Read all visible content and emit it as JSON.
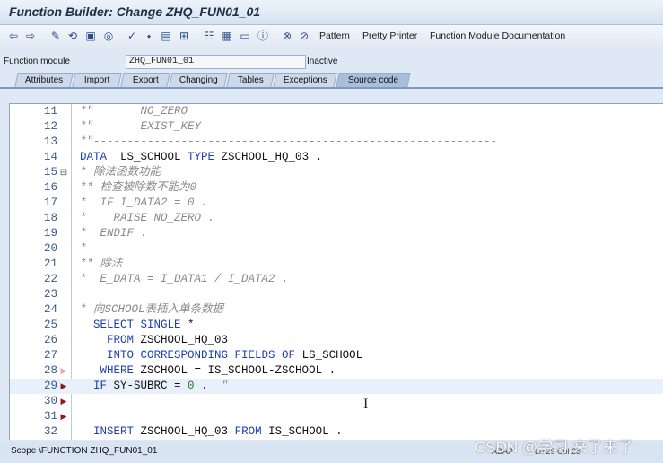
{
  "window": {
    "title": "Function Builder: Change ZHQ_FUN01_01"
  },
  "toolbar": {
    "icons": [
      "back-arrow-icon",
      "forward-arrow-icon",
      "edit-pencil-icon",
      "toggle-display-change-icon",
      "other-object-icon",
      "activate-icon",
      "check-icon",
      "where-used-icon",
      "breakpoint-icon",
      "pretty-print-icon",
      "display-object-list-icon",
      "navigate-icon",
      "test-icon",
      "insert-statement-icon",
      "info-icon",
      "stop-icon",
      "stop-all-icon"
    ],
    "pattern_label": "Pattern",
    "pretty_printer_label": "Pretty Printer",
    "doc_label": "Function Module Documentation"
  },
  "header": {
    "field_label": "Function module",
    "field_value": "ZHQ_FUN01_01",
    "status": "Inactive"
  },
  "tabs": [
    {
      "label": "Attributes"
    },
    {
      "label": "Import"
    },
    {
      "label": "Export"
    },
    {
      "label": "Changing"
    },
    {
      "label": "Tables"
    },
    {
      "label": "Exceptions"
    },
    {
      "label": "Source code",
      "active": true
    }
  ],
  "editor": {
    "lines": [
      {
        "n": "11",
        "mark": "",
        "parts": [
          [
            "cm",
            "*\"       NO_ZERO"
          ]
        ]
      },
      {
        "n": "12",
        "mark": "",
        "parts": [
          [
            "cm",
            "*\"       EXIST_KEY"
          ]
        ]
      },
      {
        "n": "13",
        "mark": "",
        "parts": [
          [
            "cm",
            "*\"------------------------------------------------------------"
          ]
        ]
      },
      {
        "n": "14",
        "mark": "",
        "parts": [
          [
            "kw",
            "DATA"
          ],
          [
            "tx",
            "  LS_SCHOOL "
          ],
          [
            "kw",
            "TYPE"
          ],
          [
            "tx",
            " ZSCHOOL_HQ_03 ."
          ]
        ]
      },
      {
        "n": "15",
        "mark": "⊟",
        "parts": [
          [
            "cm",
            "* 除法函数功能"
          ]
        ]
      },
      {
        "n": "16",
        "mark": "",
        "parts": [
          [
            "cm",
            "** 检查被除数不能为0"
          ]
        ]
      },
      {
        "n": "17",
        "mark": "",
        "parts": [
          [
            "cm",
            "*  IF I_DATA2 = 0 ."
          ]
        ]
      },
      {
        "n": "18",
        "mark": "",
        "parts": [
          [
            "cm",
            "*    RAISE NO_ZERO ."
          ]
        ]
      },
      {
        "n": "19",
        "mark": "",
        "parts": [
          [
            "cm",
            "*  ENDIF ."
          ]
        ]
      },
      {
        "n": "20",
        "mark": "",
        "parts": [
          [
            "cm",
            "*"
          ]
        ]
      },
      {
        "n": "21",
        "mark": "",
        "parts": [
          [
            "cm",
            "** 除法"
          ]
        ]
      },
      {
        "n": "22",
        "mark": "",
        "parts": [
          [
            "cm",
            "*  E_DATA = I_DATA1 / I_DATA2 ."
          ]
        ]
      },
      {
        "n": "23",
        "mark": "",
        "parts": [
          [
            "tx",
            ""
          ]
        ]
      },
      {
        "n": "24",
        "mark": "",
        "parts": [
          [
            "cm",
            "* 向SCHOOL表插入单条数据"
          ]
        ]
      },
      {
        "n": "25",
        "mark": "",
        "parts": [
          [
            "tx",
            "  "
          ],
          [
            "kw",
            "SELECT SINGLE"
          ],
          [
            "tx",
            " *"
          ]
        ]
      },
      {
        "n": "26",
        "mark": "",
        "parts": [
          [
            "tx",
            "    "
          ],
          [
            "kw",
            "FROM"
          ],
          [
            "tx",
            " ZSCHOOL_HQ_03"
          ]
        ]
      },
      {
        "n": "27",
        "mark": "",
        "parts": [
          [
            "tx",
            "    "
          ],
          [
            "kw",
            "INTO CORRESPONDING FIELDS OF"
          ],
          [
            "tx",
            " LS_SCHOOL"
          ]
        ]
      },
      {
        "n": "28",
        "mark": "bpl",
        "parts": [
          [
            "tx",
            "   "
          ],
          [
            "kw",
            "WHERE"
          ],
          [
            "tx",
            " ZSCHOOL = IS_SCHOOL-ZSCHOOL ."
          ]
        ]
      },
      {
        "n": "29",
        "mark": "bp",
        "hl": true,
        "parts": [
          [
            "tx",
            "  "
          ],
          [
            "kw",
            "IF"
          ],
          [
            "tx",
            " SY-SUBRC = "
          ],
          [
            "st",
            "0"
          ],
          [
            "tx",
            " .  "
          ],
          [
            "cm",
            "\""
          ]
        ]
      },
      {
        "n": "30",
        "mark": "bp",
        "parts": [
          [
            "tx",
            ""
          ]
        ]
      },
      {
        "n": "31",
        "mark": "bp",
        "parts": [
          [
            "tx",
            ""
          ]
        ]
      },
      {
        "n": "32",
        "mark": "",
        "parts": [
          [
            "tx",
            "  "
          ],
          [
            "kw",
            "INSERT"
          ],
          [
            "tx",
            " ZSCHOOL_HQ_03 "
          ],
          [
            "kw",
            "FROM"
          ],
          [
            "tx",
            " IS_SCHOOL ."
          ]
        ]
      }
    ]
  },
  "statusbar": {
    "scope": "Scope \\FUNCTION ZHQ_FUN01_01",
    "sys": "ABAP",
    "pos": "Ln 29 Col 23"
  },
  "watermark": "CSDN @学习 来了来了"
}
